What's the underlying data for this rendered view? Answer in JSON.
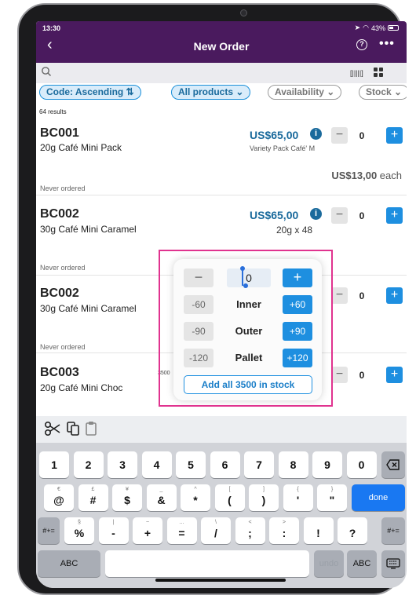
{
  "status": {
    "time": "13:30",
    "battery": "43%"
  },
  "header": {
    "title": "New Order",
    "back_icon": "chevron-left-icon",
    "help_label": "?",
    "more_label": "•••"
  },
  "search": {
    "placeholder": ""
  },
  "chips": [
    {
      "label": "Code: Ascending ⇅",
      "active": true
    },
    {
      "label": "All products ⌄",
      "active": true
    },
    {
      "label": "Availability ⌄",
      "active": false
    },
    {
      "label": "Stock ⌄",
      "active": false
    }
  ],
  "results_count": "64 results",
  "products": [
    {
      "code": "BC001",
      "name": "20g Café Mini Pack",
      "price": "US$65,00",
      "subinfo": "Variety Pack Café' M",
      "each_price": "US$13,00",
      "each_suffix": " each",
      "qty": "0",
      "history": "Never ordered"
    },
    {
      "code": "BC002",
      "name": "30g Café Mini Caramel",
      "price": "US$65,00",
      "pack": "20g x 48",
      "qty": "0",
      "history": "Never ordered"
    },
    {
      "code": "BC002",
      "name": "30g Café Mini Caramel",
      "qty": "0",
      "history": "Never ordered"
    },
    {
      "code": "BC003",
      "name": "20g Café Mini Choc",
      "stock_peek": "3500",
      "qty": "0"
    }
  ],
  "popup": {
    "minus_label": "−",
    "plus_label": "+",
    "input_value": "0",
    "steps": [
      {
        "minus": "-60",
        "label": "Inner",
        "plus": "+60"
      },
      {
        "minus": "-90",
        "label": "Outer",
        "plus": "+90"
      },
      {
        "minus": "-120",
        "label": "Pallet",
        "plus": "+120"
      }
    ],
    "add_all_label": "Add all 3500 in stock"
  },
  "keyboard": {
    "row1": [
      "1",
      "2",
      "3",
      "4",
      "5",
      "6",
      "7",
      "8",
      "9",
      "0"
    ],
    "row2": [
      {
        "alt": "€",
        "main": "@"
      },
      {
        "alt": "£",
        "main": "#"
      },
      {
        "alt": "¥",
        "main": "$"
      },
      {
        "alt": "_",
        "main": "&"
      },
      {
        "alt": "^",
        "main": "*"
      },
      {
        "alt": "[",
        "main": "("
      },
      {
        "alt": "]",
        "main": ")"
      },
      {
        "alt": "{",
        "main": "'"
      },
      {
        "alt": "}",
        "main": "\""
      }
    ],
    "row3": [
      {
        "alt": "§",
        "main": "%"
      },
      {
        "alt": "|",
        "main": "-"
      },
      {
        "alt": "~",
        "main": "+"
      },
      {
        "alt": "…",
        "main": "="
      },
      {
        "alt": "\\",
        "main": "/"
      },
      {
        "alt": "<",
        "main": ";"
      },
      {
        "alt": ">",
        "main": ":"
      },
      {
        "alt": "",
        "main": "!"
      },
      {
        "alt": "",
        "main": "?"
      }
    ],
    "done_label": "done",
    "symbols_label": "#+=",
    "abc_label": "ABC",
    "undo_label": "undo",
    "delete_icon": "backspace-icon",
    "keyboard_icon": "keyboard-icon"
  }
}
